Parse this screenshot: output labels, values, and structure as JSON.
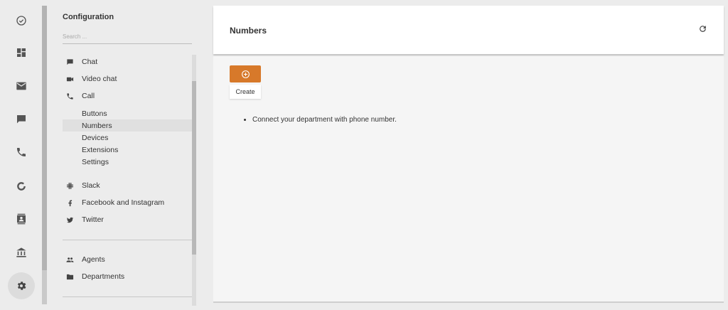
{
  "rail": {
    "items": [
      {
        "icon": "check-circle-icon"
      },
      {
        "icon": "dashboard-icon"
      },
      {
        "icon": "mail-icon"
      },
      {
        "icon": "chat-icon"
      },
      {
        "icon": "phone-icon"
      },
      {
        "icon": "donut-chart-icon"
      },
      {
        "icon": "contacts-icon"
      },
      {
        "icon": "bank-icon"
      },
      {
        "icon": "settings-icon",
        "active": true
      }
    ]
  },
  "config": {
    "title": "Configuration",
    "search_placeholder": "Search ...",
    "channels": [
      {
        "label": "Chat",
        "icon": "chat-icon"
      },
      {
        "label": "Video chat",
        "icon": "video-icon"
      },
      {
        "label": "Call",
        "icon": "phone-icon"
      }
    ],
    "call_sub_items": [
      {
        "label": "Buttons"
      },
      {
        "label": "Numbers",
        "active": true
      },
      {
        "label": "Devices"
      },
      {
        "label": "Extensions"
      },
      {
        "label": "Settings"
      }
    ],
    "integrations": [
      {
        "label": "Slack",
        "icon": "slack-icon"
      },
      {
        "label": "Facebook and Instagram",
        "icon": "facebook-icon"
      },
      {
        "label": "Twitter",
        "icon": "twitter-icon"
      }
    ],
    "team": [
      {
        "label": "Agents",
        "icon": "people-icon"
      },
      {
        "label": "Departments",
        "icon": "folder-icon"
      }
    ]
  },
  "main": {
    "title": "Numbers",
    "create_label": "Create",
    "info_items": [
      "Connect your department with phone number."
    ]
  },
  "colors": {
    "accent": "#d7792a",
    "background": "#ececec",
    "panel": "#ffffff"
  }
}
